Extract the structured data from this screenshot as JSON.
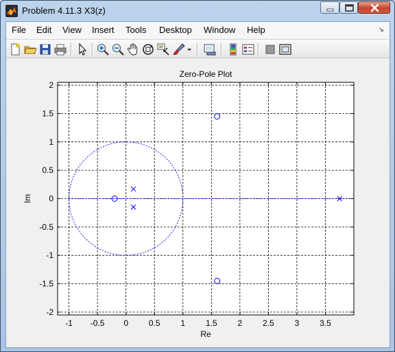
{
  "window": {
    "title": "Problem 4.11.3 X3(z)"
  },
  "menu": [
    "File",
    "Edit",
    "View",
    "Insert",
    "Tools",
    "Desktop",
    "Window",
    "Help"
  ],
  "toolbar": {
    "icons": [
      "new-figure-icon",
      "open-file-icon",
      "save-icon",
      "print-icon",
      "edit-plot-arrow-icon",
      "zoom-in-icon",
      "zoom-out-icon",
      "pan-hand-icon",
      "rotate-3d-icon",
      "data-cursor-icon",
      "brush-icon",
      "link-plot-icon",
      "colorbar-icon",
      "legend-icon",
      "hide-plot-tools-icon",
      "show-plot-tools-icon"
    ]
  },
  "colors": {
    "plot_blue": "#0000ff",
    "grid": "#000000"
  },
  "chart_data": {
    "type": "scatter",
    "title": "Zero-Pole Plot",
    "xlabel": "Re",
    "ylabel": "Im",
    "xlim": [
      -1.2,
      4.0
    ],
    "ylim": [
      -2.05,
      2.05
    ],
    "xticks": [
      -1,
      -0.5,
      0,
      0.5,
      1,
      1.5,
      2,
      2.5,
      3,
      3.5
    ],
    "xtick_labels": [
      "-1",
      "-0.5",
      "0",
      "0.5",
      "1",
      "1.5",
      "2",
      "2.5",
      "3",
      "3.5"
    ],
    "yticks": [
      -2,
      -1.5,
      -1,
      -0.5,
      0,
      0.5,
      1,
      1.5,
      2
    ],
    "ytick_labels": [
      "-2",
      "-1.5",
      "-1",
      "-0.5",
      "0",
      "0.5",
      "1",
      "1.5",
      "2"
    ],
    "grid": true,
    "unit_circle": true,
    "series": [
      {
        "marker": "o",
        "x": [
          -0.2,
          1.6,
          1.6
        ],
        "y": [
          0,
          1.45,
          -1.45
        ]
      },
      {
        "marker": "x",
        "x": [
          0.13,
          0.13,
          3.75
        ],
        "y": [
          0.17,
          -0.15,
          0
        ]
      }
    ]
  }
}
